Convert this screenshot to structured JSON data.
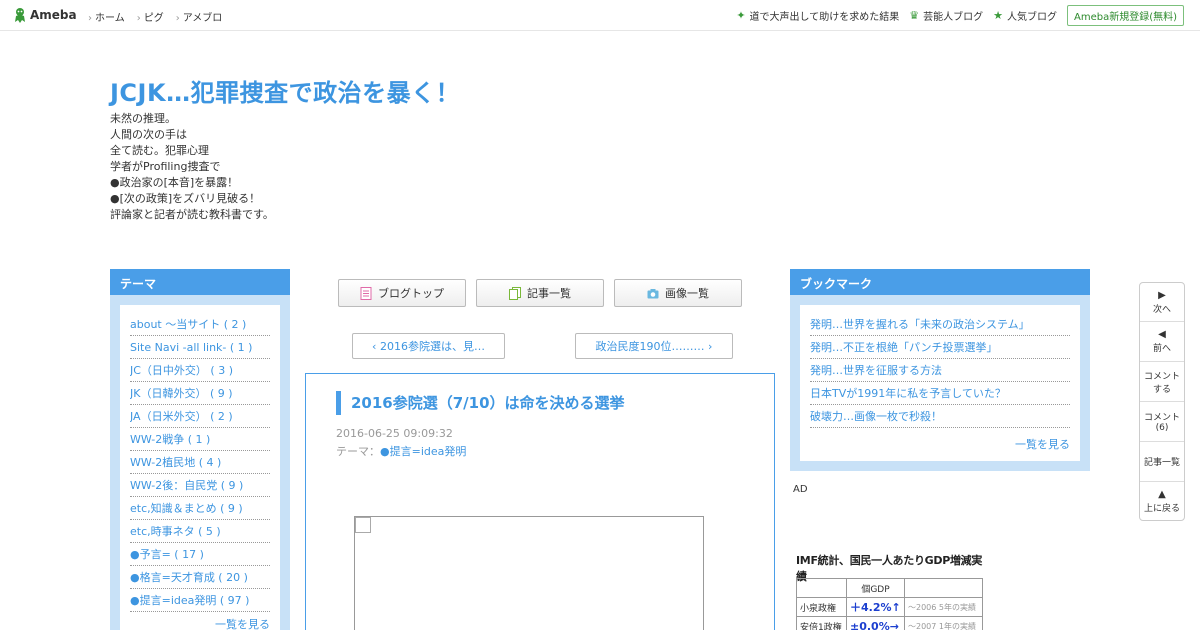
{
  "topbar": {
    "logo_text": "Ameba",
    "nav": [
      "ホーム",
      "ピグ",
      "アメブロ"
    ],
    "right_links": [
      {
        "icon": "sparkle-icon",
        "label": "道で大声出して助けを求めた結果"
      },
      {
        "icon": "crown-icon",
        "label": "芸能人ブログ"
      },
      {
        "icon": "star-icon",
        "label": "人気ブログ"
      }
    ],
    "register_label": "Ameba新規登録(無料)"
  },
  "header": {
    "title": "JCJK…犯罪捜査で政治を暴く！",
    "description": [
      "未然の推理。",
      "人間の次の手は",
      "全て読む。犯罪心理",
      "学者がProfiling捜査で",
      "●政治家の[本音]を暴露！",
      "●[次の政策]をズバリ見破る！",
      "評論家と記者が読む教科書です。"
    ]
  },
  "theme_box": {
    "heading": "テーマ",
    "items": [
      "about ～当サイト ( 2 )",
      "Site Navi -all link- ( 1 )",
      "JC（日中外交） ( 3 )",
      "JK（日韓外交） ( 9 )",
      "JA（日米外交） ( 2 )",
      "WW-2戦争 ( 1 )",
      "WW-2植民地 ( 4 )",
      "WW-2後：自民党 ( 9 )",
      "etc,知識＆まとめ ( 9 )",
      "etc,時事ネタ ( 5 )",
      "●予言= ( 17 )",
      "●格言=天才育成 ( 20 )",
      "●提言=idea発明 ( 97 )"
    ],
    "more": "一覧を見る"
  },
  "tabs": [
    {
      "label": "ブログトップ",
      "icon": "document-icon"
    },
    {
      "label": "記事一覧",
      "icon": "copy-icon"
    },
    {
      "label": "画像一覧",
      "icon": "camera-icon"
    }
  ],
  "pager": {
    "prev": "2016参院選は、見…",
    "next": "政治民度190位………"
  },
  "article": {
    "title": "2016参院選（7/10）は命を決める選挙",
    "date": "2016-06-25 09:09:32",
    "theme_prefix": "テーマ：",
    "theme_value": "●提言=idea発明"
  },
  "bookmark_box": {
    "heading": "ブックマーク",
    "items": [
      "発明…世界を握れる「未来の政治システム」",
      "発明…不正を根絶「パンチ投票選挙」",
      "発明…世界を征服する方法",
      "日本TVが1991年に私を予言していた？",
      "破壊力…画像一枚で秒殺！"
    ],
    "more": "一覧を見る"
  },
  "ad": {
    "label": "AD",
    "title": "IMF統計、国民一人あたりGDP増減実績",
    "header_cell": "個GDP",
    "rows": [
      {
        "name": "小泉政権",
        "value": "＋4.2%↑",
        "note": "～2006 5年の実績"
      },
      {
        "name": "安倍1政権",
        "value": "±0.0%→",
        "note": "～2007 1年の実績"
      }
    ]
  },
  "float_nav": [
    {
      "arrow": "▶",
      "label": "次へ"
    },
    {
      "arrow": "◀",
      "label": "前へ"
    },
    {
      "arrow": "",
      "label": "コメントする"
    },
    {
      "arrow": "",
      "label": "コメント(6)"
    },
    {
      "arrow": "",
      "label": "記事一覧"
    },
    {
      "arrow": "▲",
      "label": "上に戻る"
    }
  ],
  "colors": {
    "accent": "#3d95e0",
    "box_bg": "#c8e1f7",
    "box_head": "#4a9ee8",
    "brand_green": "#3a9a3a"
  }
}
